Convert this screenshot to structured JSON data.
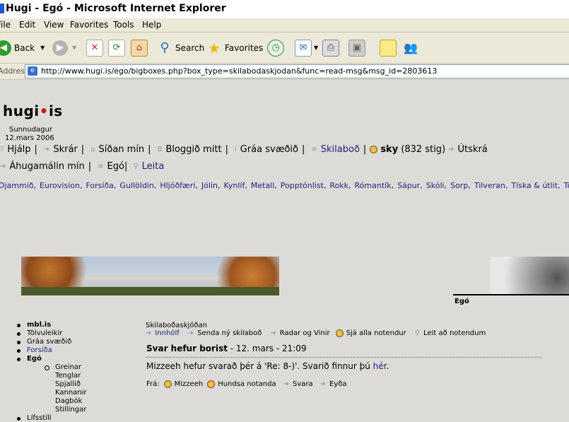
{
  "window": {
    "title": "Hugi - Egó - Microsoft Internet Explorer"
  },
  "menu": [
    "File",
    "Edit",
    "View",
    "Favorites",
    "Tools",
    "Help"
  ],
  "toolbar": {
    "back": "Back",
    "search": "Search",
    "favorites": "Favorites"
  },
  "address": {
    "label": "Address",
    "url": "http://www.hugi.is/ego/bigboxes.php?box_type=skilabodaskjodan&func=read-msg&msg_id=2803613"
  },
  "site": {
    "logo_left": "hugi",
    "logo_dot": "•",
    "logo_right": "is",
    "day": "Sunnudagur",
    "date": "12.mars 2006"
  },
  "nav1": {
    "hjalp": "Hjálp",
    "skrar": "Skrár",
    "sidan": "Síðan mín",
    "blogg": "Bloggið mitt",
    "graa": "Gráa svæðið",
    "skilabod": "Skilaboð",
    "user": "sky",
    "points": "(832 stig)",
    "utskra": "Útskrá"
  },
  "nav2": {
    "ahuga": "Áhugamálin mín",
    "ego": "Egó",
    "leita": "Leita"
  },
  "categories": [
    "Djammið,",
    "Eurovision,",
    "Forsíða,",
    "Gullöldin,",
    "Hljóðfæri,",
    "Jólin,",
    "Kynlíf,",
    "Metall,",
    "Popptónlist,",
    "Rokk,",
    "Rómantík,",
    "Sápur,",
    "Skóli,",
    "Sorp,",
    "Tilveran,",
    "Tíska & útlit,",
    "Tö"
  ],
  "ego_label": "Egó",
  "sidebar": {
    "mbl": "mbl.is",
    "tolvu": "Tölvuleikir",
    "graa": "Gráa svæðið",
    "forsida": "Forsíða",
    "ego": "Egó",
    "sub": [
      "Greinar",
      "Tenglar",
      "Spjallið",
      "Kannanir",
      "Dagbók",
      "Stillingar"
    ],
    "lifsstill": "Lífsstíll"
  },
  "message": {
    "box_title": "Skilaboðaskjóðan",
    "nav": {
      "inbox": "Innhólf",
      "send": "Senda ný skilaboð",
      "radar": "Radar og Vinir",
      "sja": "Sjá alla notendur",
      "leit": "Leit að notendum"
    },
    "subject": "Svar hefur borist",
    "date": " - 12. mars - 21:09",
    "body": "Mizzeeh hefur svarað þér á 'Re: 8-)'. Svarið finnur þú ",
    "body_link": "hér",
    "body_end": ".",
    "from_label": "Frá:",
    "from_user": "Mizzeeh",
    "ignore": "Hundsa notanda",
    "reply": "Svara",
    "delete": "Eyða"
  },
  "colors": {
    "link": "#24237c",
    "page_bg": "#dcdbd7",
    "chrome": "#ece9d8"
  }
}
